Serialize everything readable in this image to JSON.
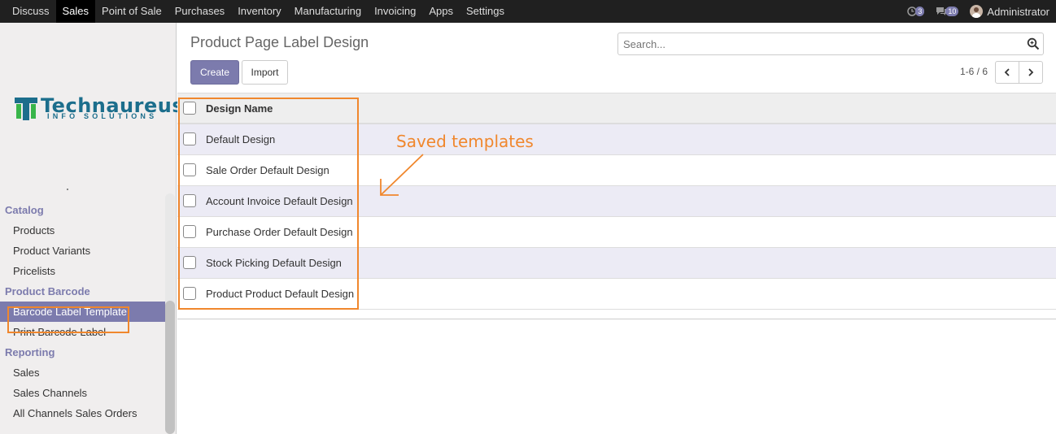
{
  "navbar": {
    "menu": [
      "Discuss",
      "Sales",
      "Point of Sale",
      "Purchases",
      "Inventory",
      "Manufacturing",
      "Invoicing",
      "Apps",
      "Settings"
    ],
    "active_menu": "Sales",
    "activity_badge": "3",
    "messages_badge": "10",
    "user_name": "Administrator"
  },
  "sidebar": {
    "logo_text": "Technaureus",
    "logo_sub": "INFO SOLUTIONS",
    "sections": [
      {
        "title": "Catalog",
        "items": [
          "Products",
          "Product Variants",
          "Pricelists"
        ]
      },
      {
        "title": "Product Barcode",
        "items": [
          "Barcode Label Template",
          "Print Barcode Label"
        ]
      },
      {
        "title": "Reporting",
        "items": [
          "Sales",
          "Sales Channels",
          "All Channels Sales Orders"
        ]
      }
    ],
    "active_item": "Barcode Label Template"
  },
  "main": {
    "title": "Product Page Label Design",
    "search_placeholder": "Search...",
    "create_label": "Create",
    "import_label": "Import",
    "pager": "1-6 / 6",
    "column_header": "Design Name",
    "rows": [
      "Default Design",
      "Sale Order Default Design",
      "Account Invoice Default Design",
      "Purchase Order Default Design",
      "Stock Picking Default Design",
      "Product Product Default Design"
    ]
  },
  "annotation": {
    "text": "Saved templates",
    "color": "#f0872d"
  },
  "colors": {
    "accent": "#7c7bad",
    "navbar": "#202020"
  }
}
